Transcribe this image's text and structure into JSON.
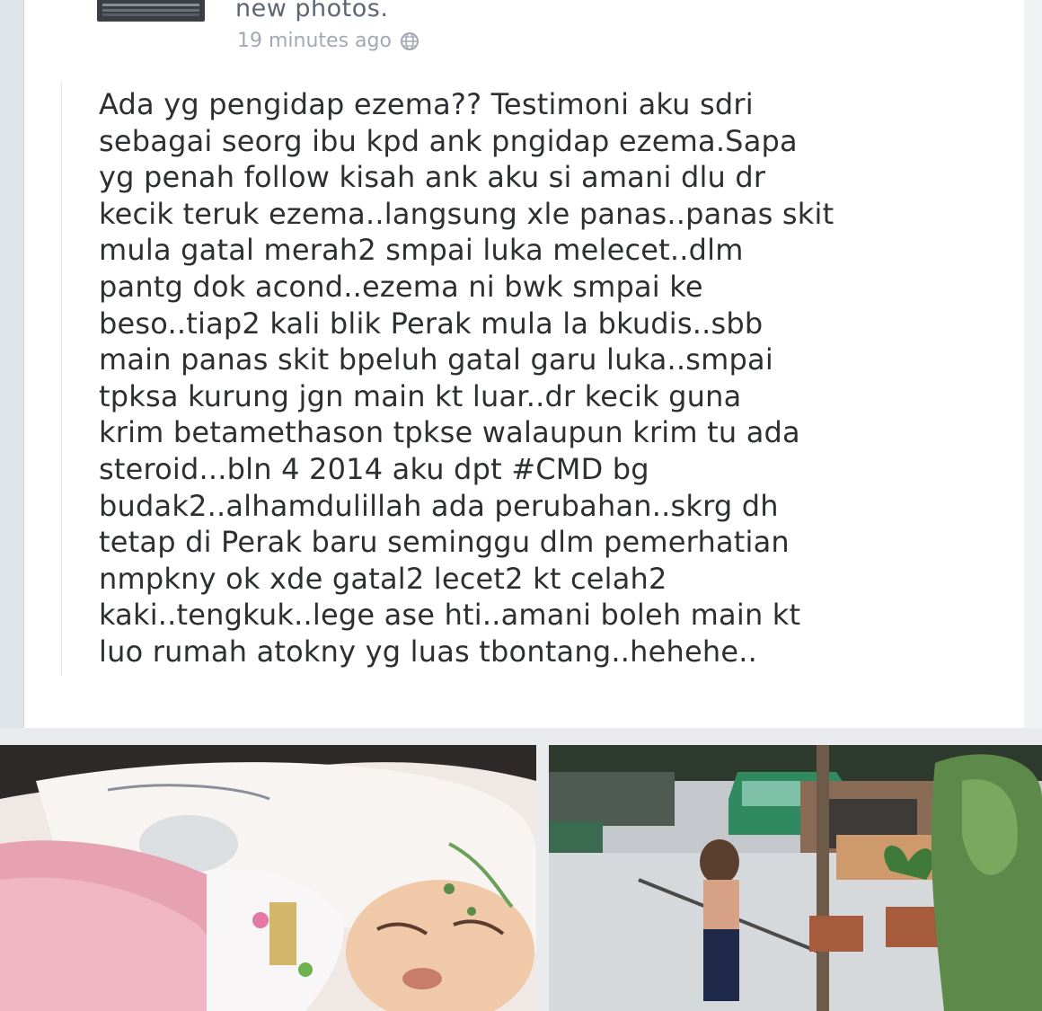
{
  "post": {
    "header_suffix": "new photos.",
    "timestamp": "19 minutes ago",
    "privacy_icon": "globe-icon",
    "body": "Ada yg pengidap ezema?? Testimoni aku sdri\nsebagai seorg ibu kpd ank pngidap ezema.Sapa\nyg penah follow kisah ank aku si amani dlu dr\nkecik teruk ezema..langsung xle panas..panas skit\nmula gatal merah2 smpai luka melecet..dlm\npantg dok acond..ezema ni bwk smpai ke\nbeso..tiap2 kali blik Perak mula la bkudis..sbb\nmain panas skit bpeluh gatal garu luka..smpai\ntpksa kurung jgn main kt luar..dr kecik guna\nkrim betamethason tpkse walaupun krim tu ada\nsteroid...bln 4 2014 aku dpt #CMD bg\nbudak2..alhamdulillah ada perubahan..skrg dh\ntetap di Perak baru seminggu dlm pemerhatian\nnmpkny ok xde gatal2 lecet2 kt celah2\nkaki..tengkuk..lege ase hti..amani boleh main kt\nluo rumah atokny yg luas tbontang..hehehe.."
  },
  "colors": {
    "background": "#e9ebee",
    "card": "#ffffff",
    "text": "#2d2f33",
    "muted": "#a3a9b3"
  }
}
